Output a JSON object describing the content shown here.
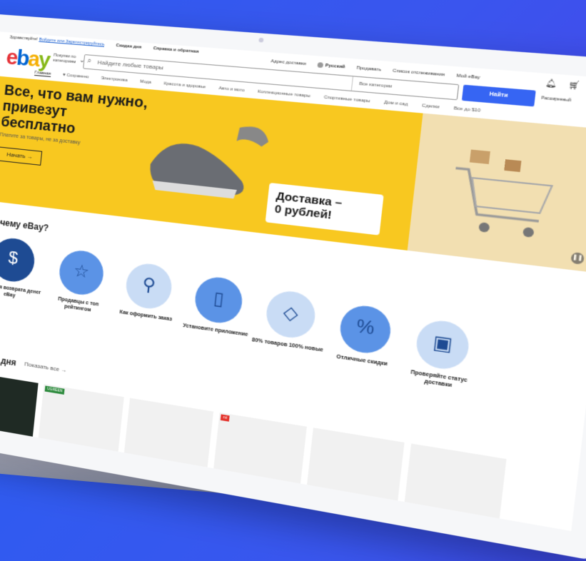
{
  "header": {
    "topline_greeting": "Здравствуйте!",
    "topline_link": "Войдите или Зарегистрируйтесь",
    "daily_deals": "Скидки дня",
    "sell_help": "Справка и обратная",
    "ship_to": "Адрес доставки",
    "language": "Русский",
    "sell": "Продавать",
    "watchlist": "Список отслеживания",
    "my_ebay": "Мой eBay",
    "shop_by_category": "Покупки по категориям",
    "search_placeholder": "Найдите любые товары",
    "all_categories": "Все категории",
    "search_button": "Найти",
    "advanced": "Расширенный"
  },
  "logo": {
    "e": "e",
    "b": "b",
    "a": "a",
    "y": "y"
  },
  "catnav": [
    "Главная",
    "♥ Сохранено",
    "Электроника",
    "Мода",
    "Красота и здоровье",
    "Авто и мото",
    "Коллекционные товары",
    "Спортивные товары",
    "Дом и сад",
    "Сделки",
    "Все до $10"
  ],
  "hero": {
    "title": "Все, что вам нужно, привезут бесплатно",
    "subtitle": "Платите за товары, не за доставку",
    "button": "Начать →",
    "delivery_line1": "Доставка –",
    "delivery_line2": "0 рублей!"
  },
  "why": {
    "title": "Почему eBay?",
    "items": [
      {
        "icon": "shield-dollar-icon",
        "glyph": "$",
        "label": "Гарантия возврата денег eBay"
      },
      {
        "icon": "star-icon",
        "glyph": "☆",
        "label": "Продавцы с топ рейтингом"
      },
      {
        "icon": "rocket-icon",
        "glyph": "⚲",
        "label": "Как оформить заказ"
      },
      {
        "icon": "phone-icon",
        "glyph": "▯",
        "label": "Установите приложение"
      },
      {
        "icon": "diamond-icon",
        "glyph": "◇",
        "label": "80% товаров 100% новые"
      },
      {
        "icon": "percent-icon",
        "glyph": "%",
        "label": "Отличные скидки"
      },
      {
        "icon": "box-icon",
        "glyph": "▣",
        "label": "Проверяйте статус доставки"
      }
    ]
  },
  "deals": {
    "title": "Скидки дня",
    "show_all": "Показать все →",
    "tiles": [
      {
        "tag": ""
      },
      {
        "tag": "UGREEN"
      },
      {
        "tag": ""
      },
      {
        "tag": "mi"
      },
      {
        "tag": ""
      },
      {
        "tag": ""
      }
    ]
  },
  "colors": {
    "background": "#3a55ee",
    "hero_yellow": "#f8c820",
    "search_button": "#3665f3",
    "badge_dark": "#1e4b93",
    "badge_light": "#c9dcf5"
  }
}
